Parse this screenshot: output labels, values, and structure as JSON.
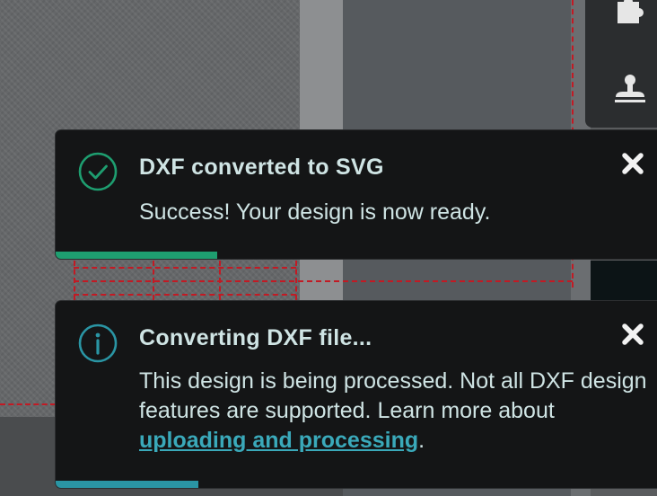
{
  "notifications": [
    {
      "type": "success",
      "icon": "check-circle-icon",
      "title": "DXF converted to SVG",
      "message": "Success! Your design is now ready.",
      "accent_color": "#1e9e70",
      "progress": 0.265
    },
    {
      "type": "info",
      "icon": "info-circle-icon",
      "title": "Converting DXF file...",
      "message_before_link": "This design is being processed. Not all DXF design features are supported. Learn more about ",
      "link_text": "uploading and processing",
      "message_after_link": ".",
      "accent_color": "#2a95a4",
      "progress": 0.235
    }
  ],
  "toolbar": {
    "icons": [
      "puzzle-icon",
      "stamp-icon"
    ]
  },
  "colors": {
    "toast_background": "#141516",
    "text": "#cfe4e4",
    "link": "#3aa9ba",
    "guide_lines": "#c21a24"
  }
}
